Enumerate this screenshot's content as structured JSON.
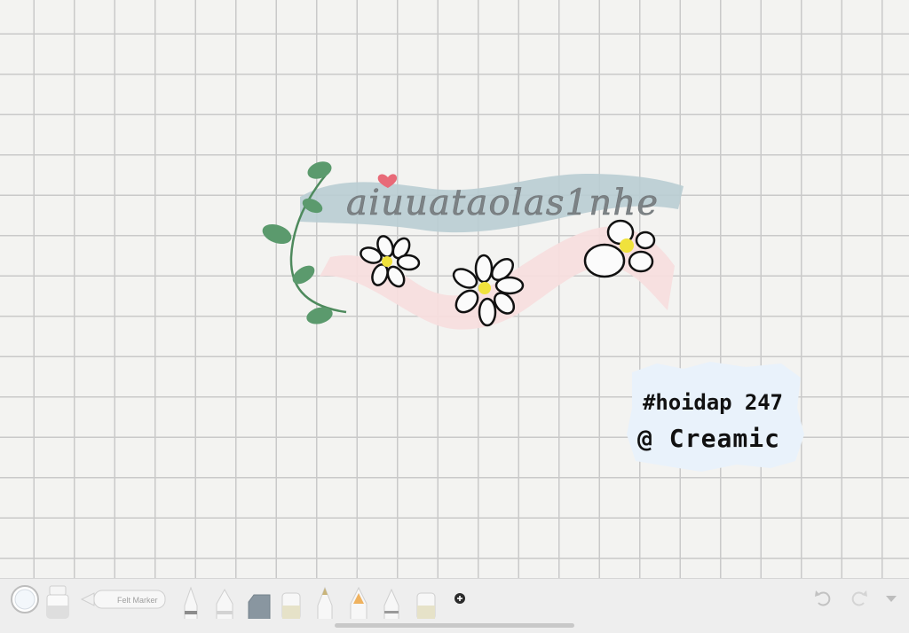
{
  "canvas": {
    "handwritten_title": "aiuuataolas1nhe",
    "note_line_1": "#hoidap 247",
    "note_line_2": "@ Creamic"
  },
  "toolbar": {
    "color_picker": "color-picker",
    "felt_marker_label": "Felt Marker",
    "add_tool_icon": "plus-circle-icon",
    "undo_icon": "undo-icon",
    "redo_icon": "redo-icon",
    "collapse_icon": "chevron-down-icon"
  },
  "colors": {
    "grid": "#c9c9c9",
    "blue_brush": "#b9cdd3",
    "pink_brush": "#f7dede",
    "leaf_green": "#5b9a6d",
    "flower_center": "#f0e23c",
    "heart": "#e86a78",
    "note_bg": "#e9f2fb"
  }
}
